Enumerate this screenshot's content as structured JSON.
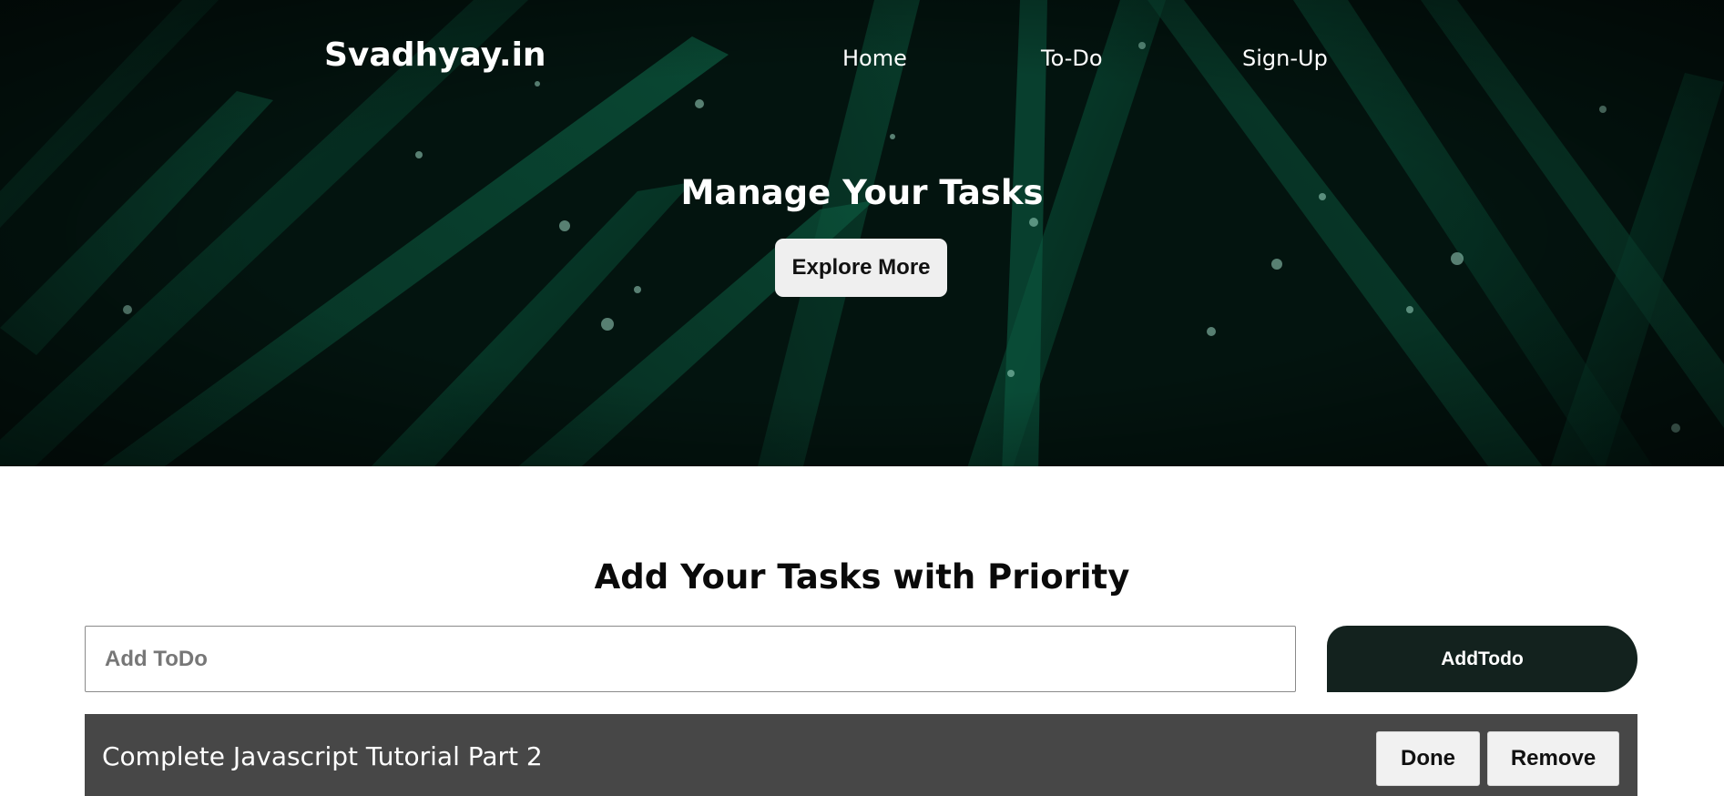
{
  "header": {
    "brand": "Svadhyay.in",
    "nav": [
      {
        "label": "Home"
      },
      {
        "label": "To-Do"
      },
      {
        "label": "Sign-Up"
      }
    ]
  },
  "hero": {
    "title": "Manage Your Tasks",
    "cta_label": "Explore More",
    "background": "dark green grass blades with water droplets"
  },
  "todo": {
    "title": "Add Your Tasks with Priority",
    "input_placeholder": "Add ToDo",
    "input_value": "",
    "add_label": "AddTodo",
    "items": [
      {
        "text": "Complete Javascript Tutorial Part 2",
        "done_label": "Done",
        "remove_label": "Remove"
      }
    ]
  },
  "colors": {
    "hero_bg": "#04211a",
    "add_button_bg": "#13221e",
    "todo_row_bg": "#474747",
    "button_light_bg": "#f1f1f1",
    "text_white": "#ffffff"
  }
}
